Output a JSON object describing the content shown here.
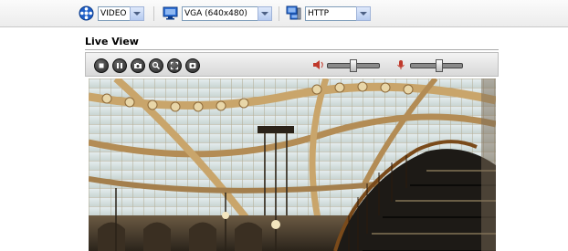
{
  "toolbar": {
    "stream": {
      "icon": "film-reel-icon",
      "selected": "VIDEO",
      "options": [
        "VIDEO"
      ]
    },
    "resolution": {
      "icon": "monitor-icon",
      "selected": "VGA (640x480)",
      "options": [
        "VGA (640x480)"
      ]
    },
    "protocol": {
      "icon": "network-computer-icon",
      "selected": "HTTP",
      "options": [
        "HTTP"
      ]
    }
  },
  "page": {
    "title": "Live View"
  },
  "controls": {
    "buttons": [
      {
        "name": "stop-button",
        "icon": "stop-icon"
      },
      {
        "name": "pause-button",
        "icon": "pause-icon"
      },
      {
        "name": "snapshot-button",
        "icon": "camera-icon"
      },
      {
        "name": "zoom-button",
        "icon": "zoom-icon"
      },
      {
        "name": "fullscreen-button",
        "icon": "fullscreen-icon"
      },
      {
        "name": "record-button",
        "icon": "record-icon"
      }
    ],
    "speaker_volume": {
      "icon": "speaker-icon",
      "level": 0.5
    },
    "microphone_volume": {
      "icon": "microphone-icon",
      "level": 0.55
    }
  },
  "video": {
    "scene": "atrium with glass skylight ceiling and staircase"
  }
}
